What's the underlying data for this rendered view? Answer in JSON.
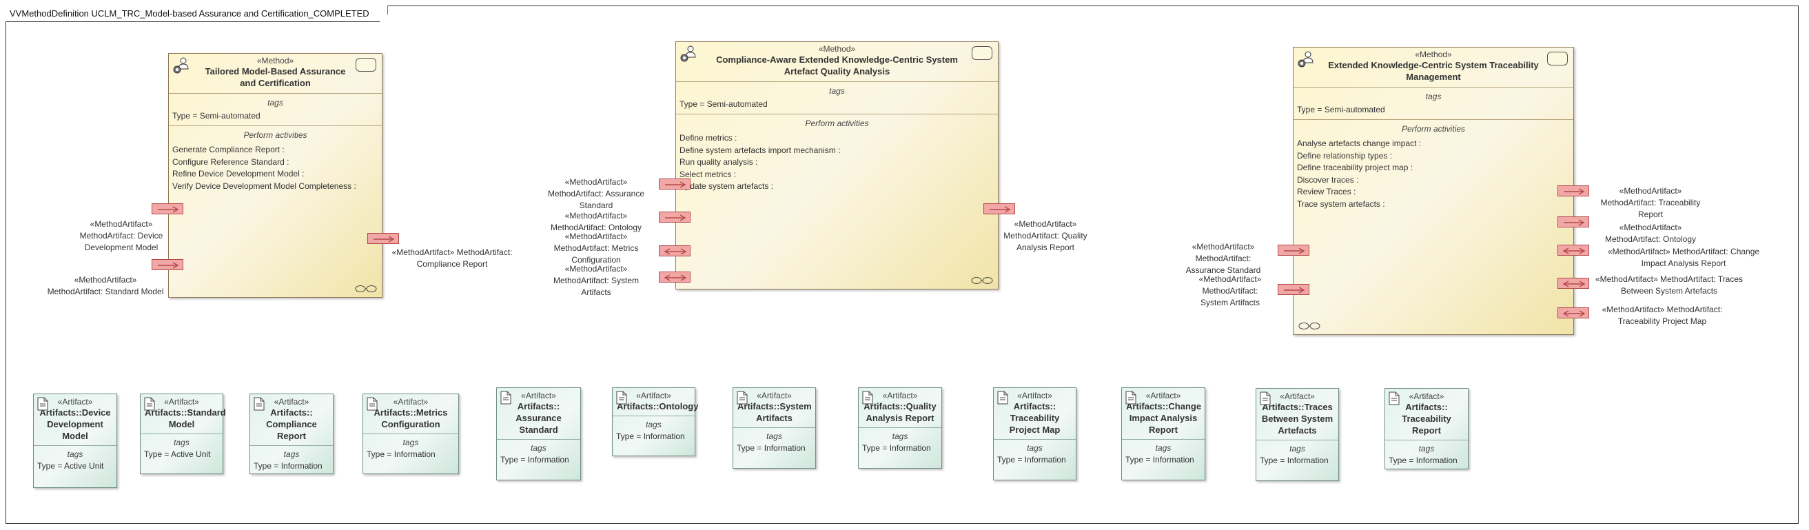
{
  "frame": {
    "title": "VVMethodDefinition UCLM_TRC_Model-based Assurance and Certification_COMPLETED"
  },
  "methods": [
    {
      "stereotype": "«Method»",
      "name": "Tailored Model-Based Assurance and Certification",
      "tags_title": "tags",
      "type": "Type = Semi-automated",
      "activities_title": "Perform activities",
      "activities": [
        "Generate Compliance Report :",
        "Configure Reference Standard :",
        "Refine Device Development Model :",
        "Verify Device Development Model Completeness :"
      ],
      "port_labels": [
        "«MethodArtifact»\nMethodArtifact: Device\nDevelopment Model",
        "«MethodArtifact»\nMethodArtifact: Standard Model",
        "«MethodArtifact» MethodArtifact:\nCompliance Report"
      ]
    },
    {
      "stereotype": "«Method»",
      "name": "Compliance-Aware Extended Knowledge-Centric System Artefact Quality Analysis",
      "tags_title": "tags",
      "type": "Type = Semi-automated",
      "activities_title": "Perform activities",
      "activities": [
        "Define metrics :",
        "Define system artefacts import mechanism :",
        "Run quality analysis :",
        "Select metrics :",
        "Update system artefacts :"
      ],
      "port_labels": [
        "«MethodArtifact»\nMethodArtifact: Assurance\nStandard",
        "«MethodArtifact»\nMethodArtifact: Ontology",
        "«MethodArtifact»\nMethodArtifact: Metrics\nConfiguration",
        "«MethodArtifact»\nMethodArtifact: System\nArtifacts",
        "«MethodArtifact»\nMethodArtifact: Quality\nAnalysis Report"
      ]
    },
    {
      "stereotype": "«Method»",
      "name": "Extended Knowledge-Centric System Traceability Management",
      "tags_title": "tags",
      "type": "Type = Semi-automated",
      "activities_title": "Perform activities",
      "activities": [
        "Analyse artefacts change impact :",
        "Define relationship types :",
        "Define traceability project map :",
        "Discover traces :",
        "Review Traces :",
        "Trace system artefacts :"
      ],
      "port_labels": [
        "«MethodArtifact»\nMethodArtifact:\nAssurance Standard",
        "«MethodArtifact»\nMethodArtifact:\nSystem Artifacts",
        "«MethodArtifact»\nMethodArtifact: Traceability\nReport",
        "«MethodArtifact»\nMethodArtifact: Ontology",
        "«MethodArtifact» MethodArtifact: Change\nImpact Analysis Report",
        "«MethodArtifact» MethodArtifact: Traces\nBetween System Artefacts",
        "«MethodArtifact» MethodArtifact:\nTraceability Project Map"
      ]
    }
  ],
  "artifacts": [
    {
      "stereotype": "«Artifact»",
      "name": "Artifacts::Device Development Model",
      "tags_title": "tags",
      "type": "Type = Active Unit"
    },
    {
      "stereotype": "«Artifact»",
      "name": "Artifacts::Standard Model",
      "tags_title": "tags",
      "type": "Type = Active Unit"
    },
    {
      "stereotype": "«Artifact»",
      "name": "Artifacts:: Compliance Report",
      "tags_title": "tags",
      "type": "Type = Information"
    },
    {
      "stereotype": "«Artifact»",
      "name": "Artifacts::Metrics Configuration",
      "tags_title": "tags",
      "type": "Type = Information"
    },
    {
      "stereotype": "«Artifact»",
      "name": "Artifacts:: Assurance Standard",
      "tags_title": "tags",
      "type": "Type = Information"
    },
    {
      "stereotype": "«Artifact»",
      "name": "Artifacts::Ontology",
      "tags_title": "tags",
      "type": "Type = Information"
    },
    {
      "stereotype": "«Artifact»",
      "name": "Artifacts::System Artifacts",
      "tags_title": "tags",
      "type": "Type = Information"
    },
    {
      "stereotype": "«Artifact»",
      "name": "Artifacts::Quality Analysis Report",
      "tags_title": "tags",
      "type": "Type = Information"
    },
    {
      "stereotype": "«Artifact»",
      "name": "Artifacts:: Traceability Project Map",
      "tags_title": "tags",
      "type": "Type = Information"
    },
    {
      "stereotype": "«Artifact»",
      "name": "Artifacts::Change Impact Analysis Report",
      "tags_title": "tags",
      "type": "Type = Information"
    },
    {
      "stereotype": "«Artifact»",
      "name": "Artifacts::Traces Between System Artefacts",
      "tags_title": "tags",
      "type": "Type = Information"
    },
    {
      "stereotype": "«Artifact»",
      "name": "Artifacts:: Traceability Report",
      "tags_title": "tags",
      "type": "Type = Information"
    }
  ],
  "colors": {
    "method_fill": "#fbf6e4",
    "artifact_fill": "#e3f3ee",
    "port_fill": "#f2a7a7",
    "port_border": "#b44848"
  }
}
